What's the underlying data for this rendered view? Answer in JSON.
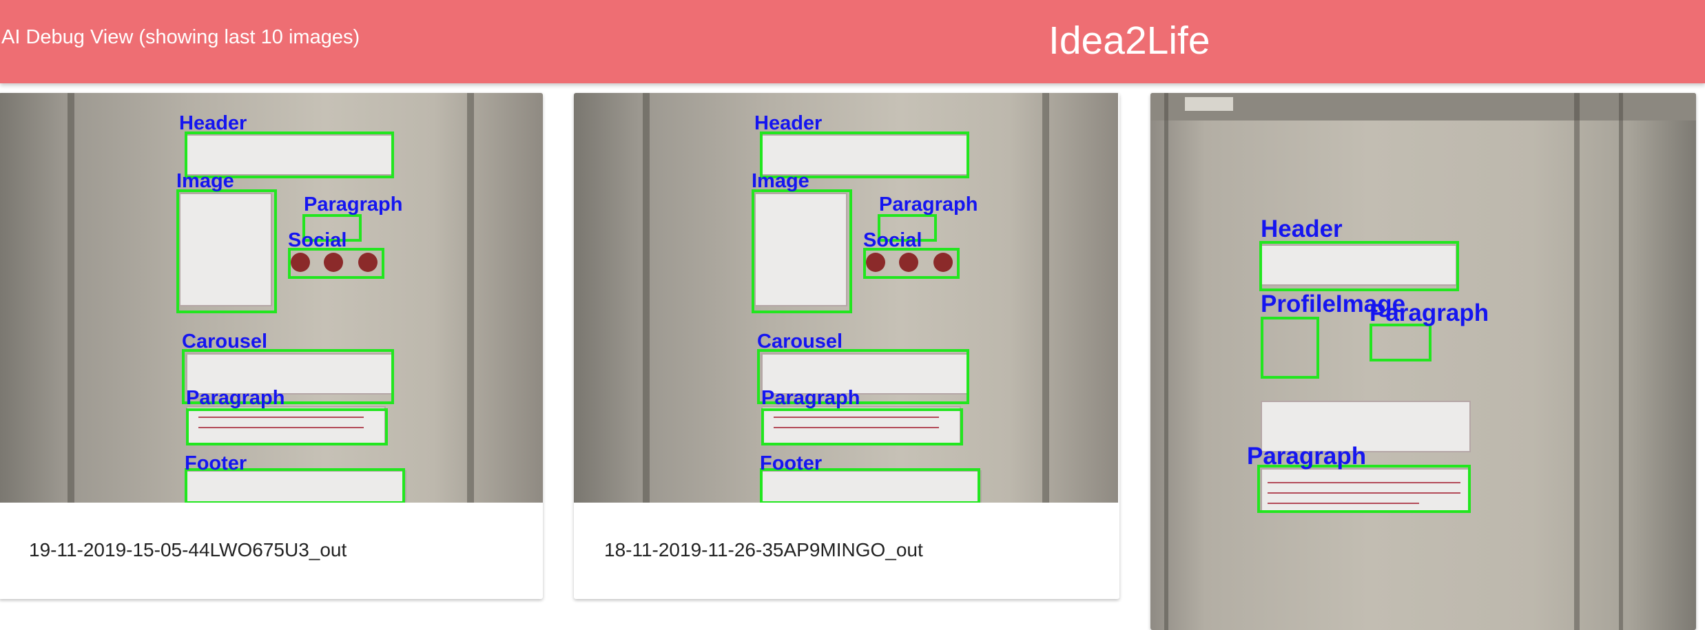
{
  "header": {
    "debug_title": "AI Debug View (showing last 10 images)",
    "brand": "Idea2Life"
  },
  "cards": [
    {
      "caption": "19-11-2019-15-05-44LWO675U3_out",
      "labels": [
        "Header",
        "Image",
        "Paragraph",
        "Social",
        "Carousel",
        "Paragraph",
        "Footer"
      ]
    },
    {
      "caption": "18-11-2019-11-26-35AP9MINGO_out",
      "labels": [
        "Header",
        "Image",
        "Paragraph",
        "Social",
        "Carousel",
        "Paragraph",
        "Footer"
      ]
    },
    {
      "caption": "",
      "labels": [
        "Header",
        "ProfileImage",
        "Paragraph",
        "Paragraph"
      ]
    }
  ],
  "colors": {
    "topbar": "#ee6e73",
    "detection_box": "#22e61f",
    "detection_label": "#1515f0"
  }
}
